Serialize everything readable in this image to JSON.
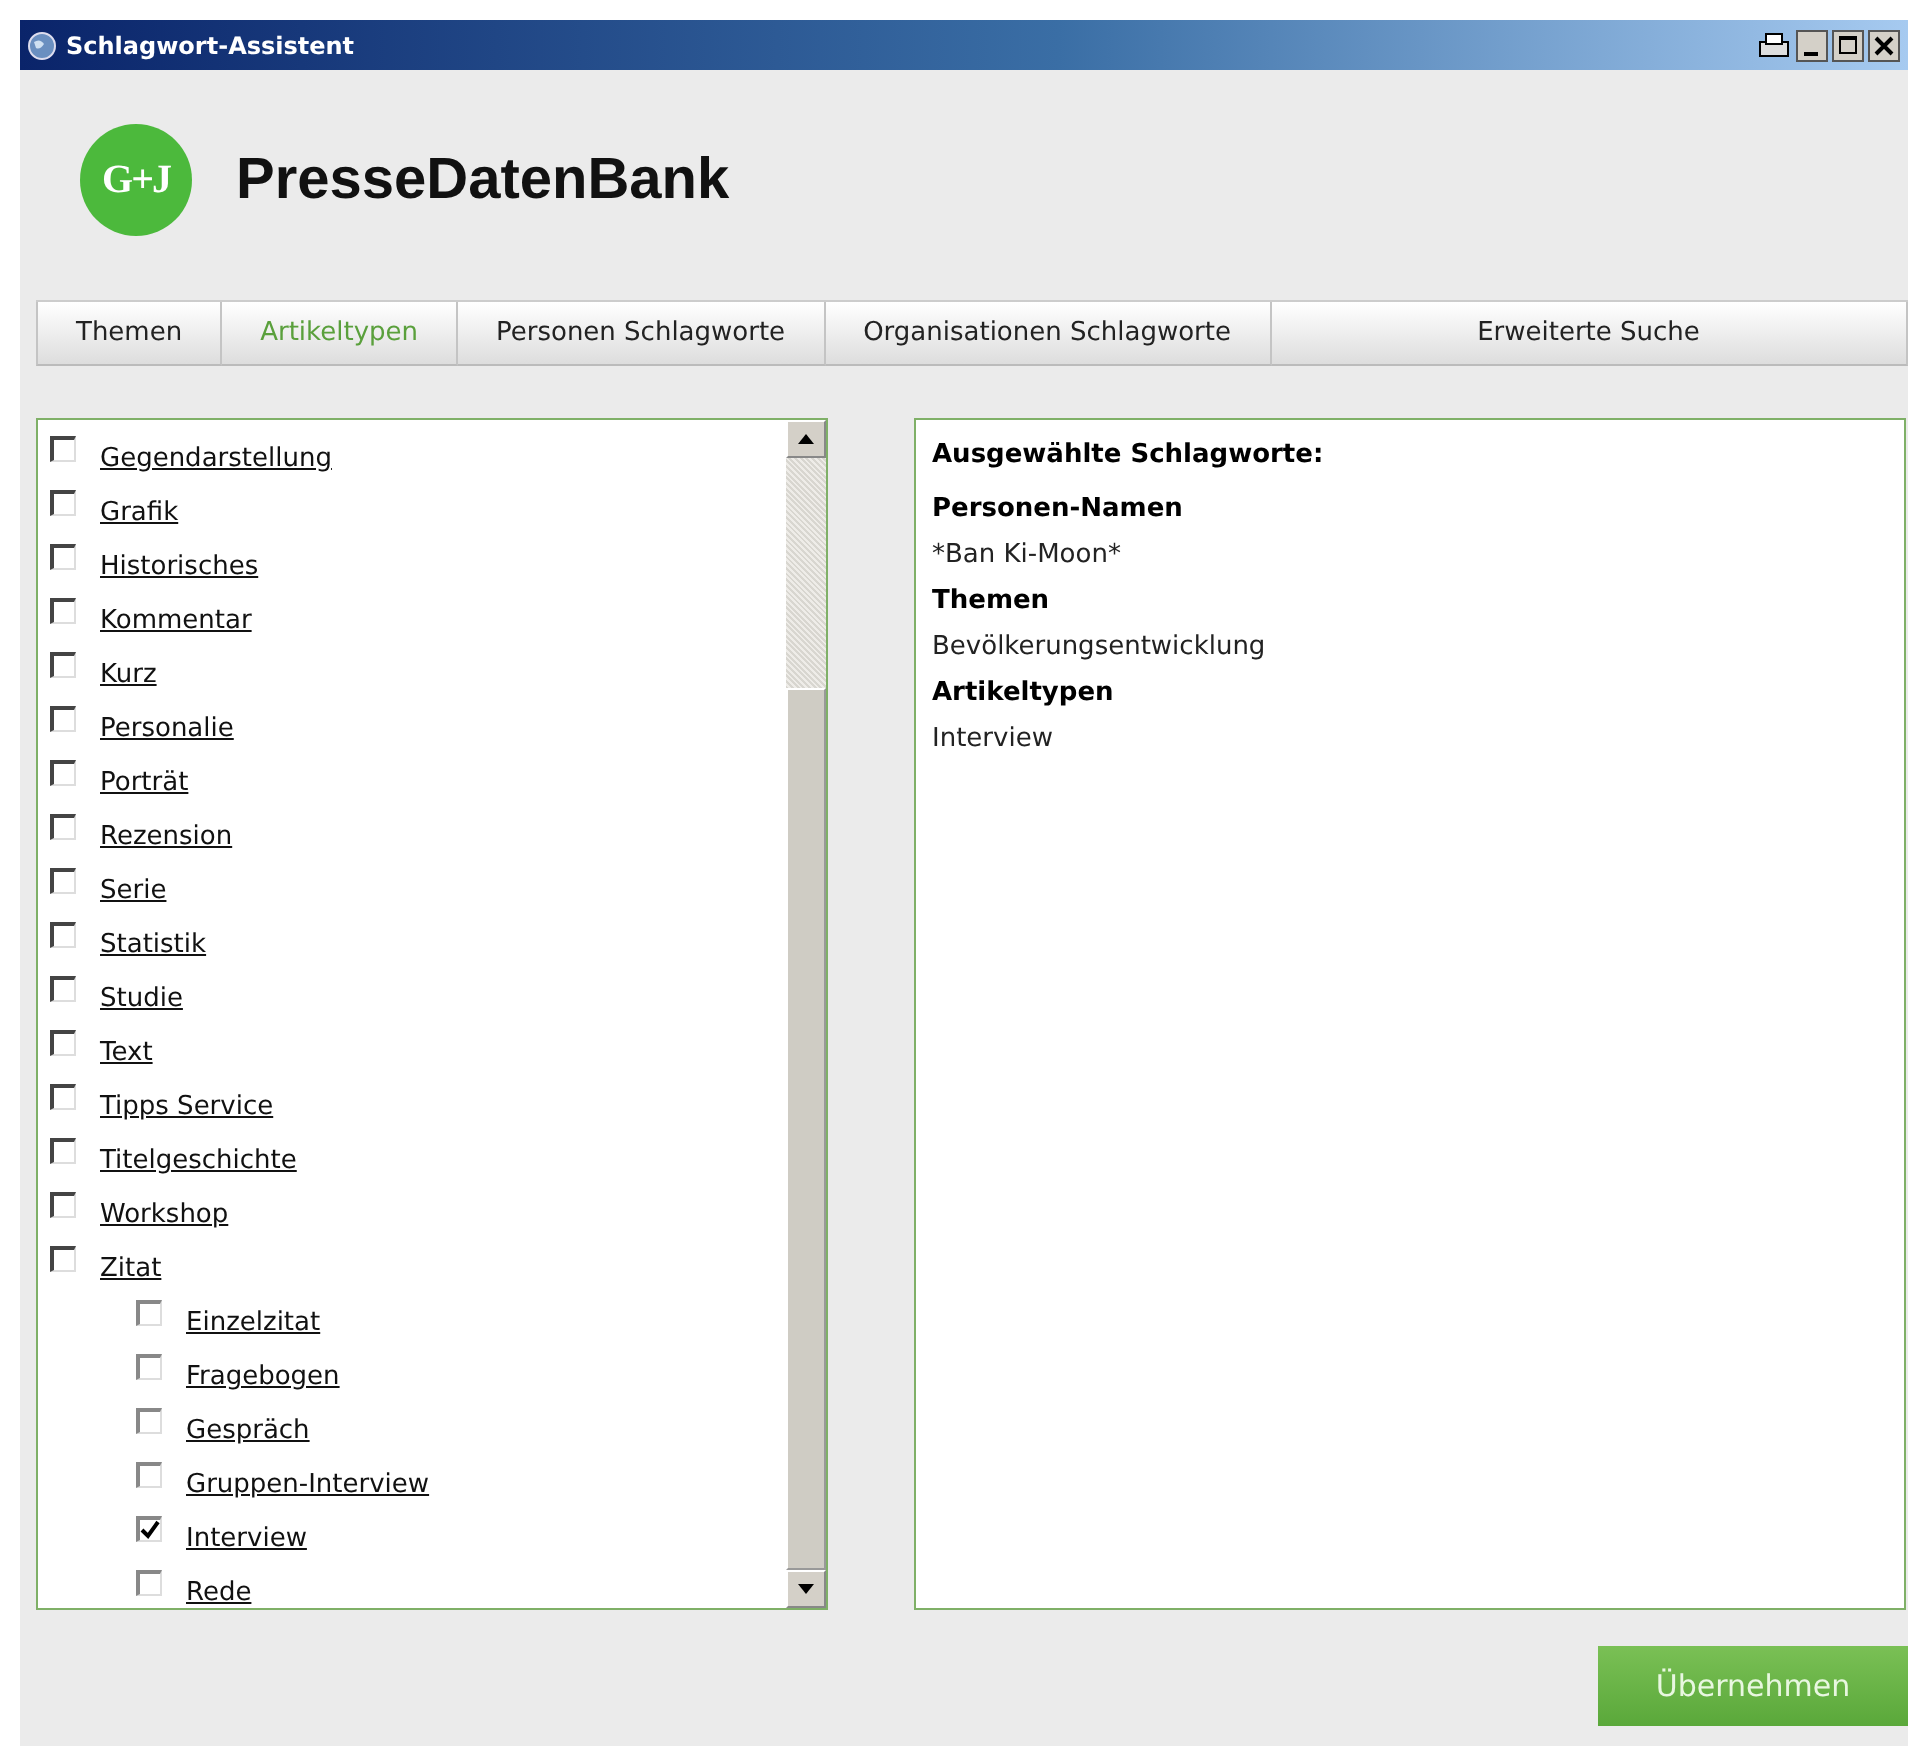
{
  "window": {
    "title": "Schlagwort-Assistent"
  },
  "logo": {
    "mark": "G+J",
    "name": "PresseDatenBank"
  },
  "tabs": [
    {
      "label": "Themen",
      "selected": false
    },
    {
      "label": "Artikeltypen",
      "selected": true
    },
    {
      "label": "Personen Schlagworte",
      "selected": false
    },
    {
      "label": "Organisationen Schlagworte",
      "selected": false
    },
    {
      "label": "Erweiterte Suche",
      "selected": false
    }
  ],
  "types": [
    {
      "label": "Gegendarstellung",
      "checked": false
    },
    {
      "label": "Grafik",
      "checked": false
    },
    {
      "label": "Historisches",
      "checked": false
    },
    {
      "label": "Kommentar",
      "checked": false
    },
    {
      "label": "Kurz",
      "checked": false
    },
    {
      "label": "Personalie",
      "checked": false
    },
    {
      "label": "Porträt",
      "checked": false
    },
    {
      "label": "Rezension",
      "checked": false
    },
    {
      "label": "Serie",
      "checked": false
    },
    {
      "label": "Statistik",
      "checked": false
    },
    {
      "label": "Studie",
      "checked": false
    },
    {
      "label": "Text",
      "checked": false
    },
    {
      "label": "Tipps Service",
      "checked": false
    },
    {
      "label": "Titelgeschichte",
      "checked": false
    },
    {
      "label": "Workshop",
      "checked": false
    },
    {
      "label": "Zitat",
      "checked": false,
      "children": [
        {
          "label": "Einzelzitat",
          "checked": false
        },
        {
          "label": "Fragebogen",
          "checked": false
        },
        {
          "label": "Gespräch",
          "checked": false
        },
        {
          "label": "Gruppen-Interview",
          "checked": false
        },
        {
          "label": "Interview",
          "checked": true
        },
        {
          "label": "Rede",
          "checked": false
        }
      ]
    }
  ],
  "summary": {
    "title": "Ausgewählte Schlagworte:",
    "groups": [
      {
        "heading": "Personen-Namen",
        "value": "*Ban Ki-Moon*"
      },
      {
        "heading": "Themen",
        "value": "Bevölkerungsentwicklung"
      },
      {
        "heading": "Artikeltypen",
        "value": "Interview"
      }
    ]
  },
  "apply_button": "Übernehmen"
}
